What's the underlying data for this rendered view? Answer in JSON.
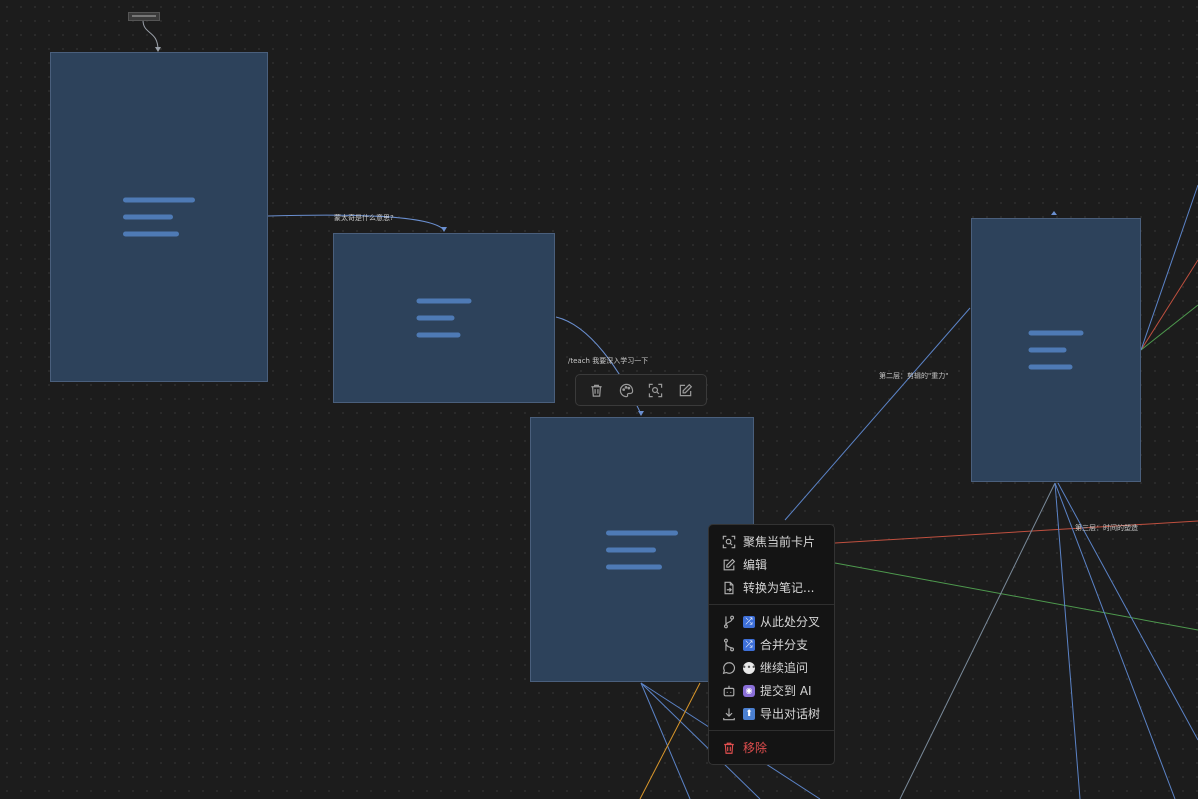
{
  "edge_labels": {
    "edge1": "蒙太奇是什么意思?",
    "edge2": "/teach 我要深入学习一下",
    "edge3": "第二层：剪辑的\"重力\"",
    "edge4": "第三层：时间的塑造"
  },
  "toolbar": {
    "delete_icon": "trash-icon",
    "color_icon": "palette-icon",
    "focus_icon": "focus-icon",
    "edit_icon": "edit-icon"
  },
  "context_menu": {
    "focus": "聚焦当前卡片",
    "edit": "编辑",
    "convert": "转换为笔记...",
    "branch": "从此处分叉",
    "merge": "合并分支",
    "followup": "继续追问",
    "submit_ai": "提交到 AI",
    "export": "导出对话树",
    "remove": "移除"
  },
  "colors": {
    "background": "#1c1c1c",
    "card": "#2d425b",
    "card_border": "#4a5f7c",
    "card_lines": "#4e7ab5",
    "edge_blue": "#5b83c7",
    "edge_red": "#c0503f",
    "edge_green": "#4e9a4e",
    "edge_orange": "#d9962a",
    "danger": "#e04e4e"
  }
}
